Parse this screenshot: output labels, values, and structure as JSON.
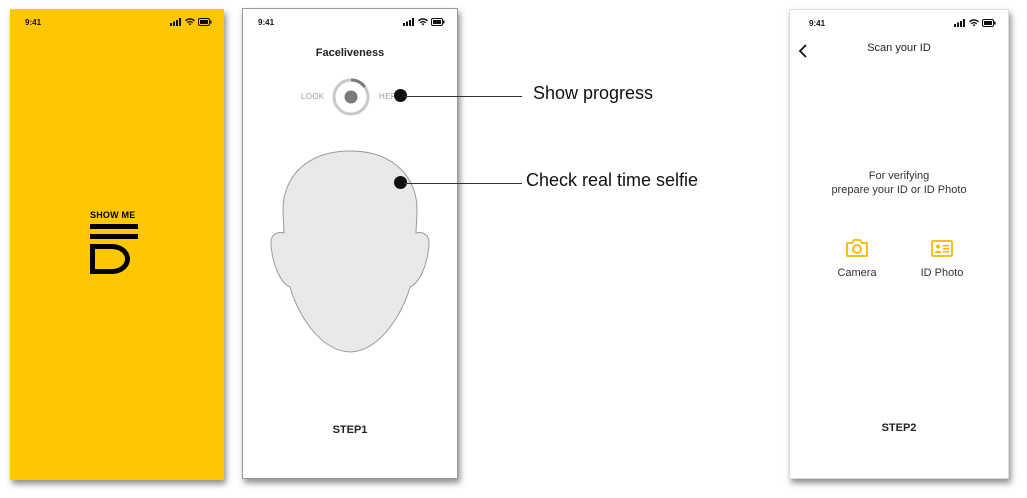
{
  "colors": {
    "brand_yellow": "#FFC700",
    "face_fill": "#e9e9e9",
    "icon_yellow": "#F5B800"
  },
  "splash": {
    "status_time": "9:41",
    "logo_text": "SHOW ME",
    "logo_mark": "ID"
  },
  "faceliveness": {
    "status_time": "9:41",
    "title": "Faceliveness",
    "look_label": "LOOK",
    "here_label": "HERE",
    "progress_fraction": 0.15,
    "step_label": "STEP1"
  },
  "annotations": {
    "progress": "Show progress",
    "selfie": "Check real time selfie"
  },
  "scan_id": {
    "status_time": "9:41",
    "title": "Scan your ID",
    "description_line1": "For verifying",
    "description_line2": "prepare your ID or ID Photo",
    "options": [
      {
        "label": "Camera",
        "icon": "camera-icon"
      },
      {
        "label": "ID Photo",
        "icon": "id-card-icon"
      }
    ],
    "step_label": "STEP2"
  }
}
